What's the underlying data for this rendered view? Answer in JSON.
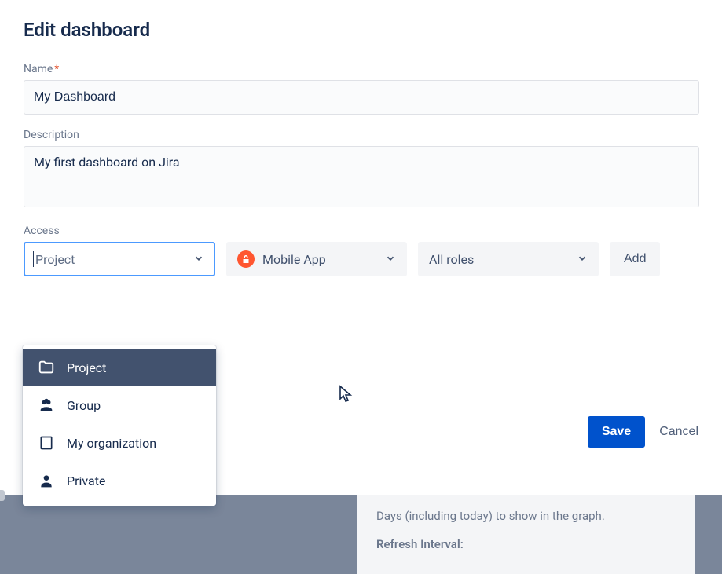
{
  "title": "Edit dashboard",
  "fields": {
    "name": {
      "label": "Name",
      "value": "My Dashboard",
      "required_mark": "*"
    },
    "description": {
      "label": "Description",
      "value": "My first dashboard on Jira"
    },
    "access": {
      "label": "Access"
    }
  },
  "access_row": {
    "scope_select": {
      "value": "Project"
    },
    "project_picker": {
      "value": "Mobile App",
      "icon_glyph": "⌘"
    },
    "role_picker": {
      "value": "All roles"
    },
    "add_button": "Add"
  },
  "dropdown_options": [
    {
      "label": "Project",
      "icon": "folder",
      "selected": true
    },
    {
      "label": "Group",
      "icon": "group",
      "selected": false
    },
    {
      "label": "My organization",
      "icon": "org",
      "selected": false
    },
    {
      "label": "Private",
      "icon": "person",
      "selected": false
    }
  ],
  "actions": {
    "save": "Save",
    "cancel": "Cancel"
  },
  "background_panel": {
    "line1": "Days (including today) to show in the graph.",
    "line2": "Refresh Interval:"
  }
}
